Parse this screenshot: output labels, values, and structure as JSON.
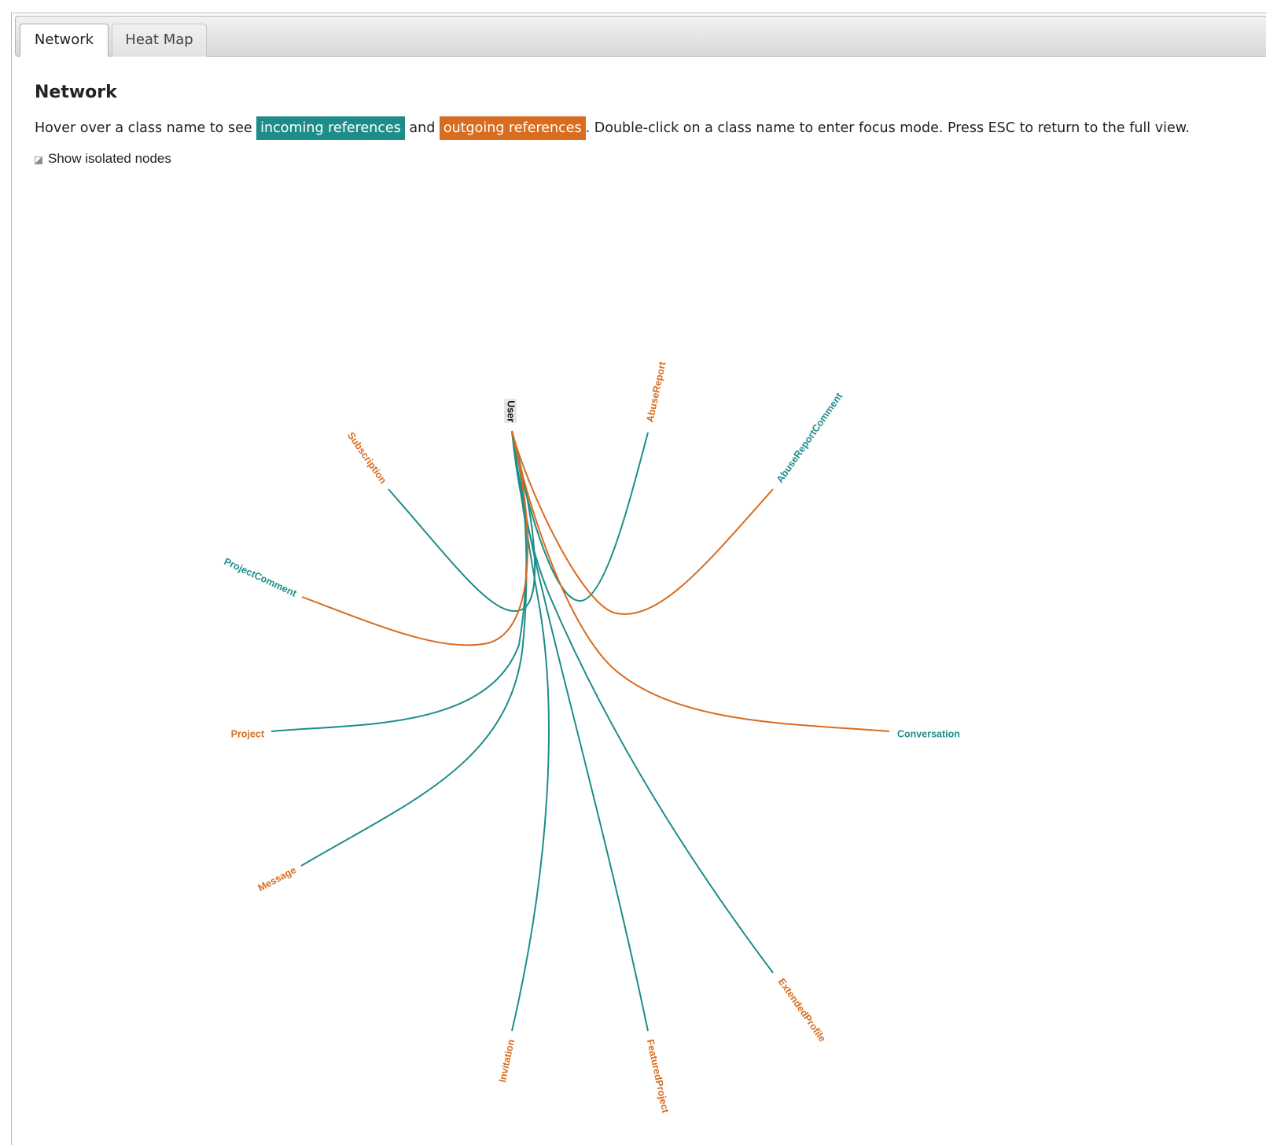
{
  "tabs": [
    {
      "label": "Network",
      "active": true
    },
    {
      "label": "Heat Map",
      "active": false
    }
  ],
  "heading": "Network",
  "description": {
    "prefix": "Hover over a class name to see ",
    "incoming": "incoming references",
    "middle": " and ",
    "outgoing": "outgoing references",
    "suffix": ". Double-click on a class name to enter focus mode. Press ESC to return to the full view."
  },
  "isolated_nodes": {
    "label": "Show isolated nodes",
    "checked": true
  },
  "colors": {
    "incoming": "#1e8d8a",
    "outgoing": "#d86c1f",
    "focus_bg": "#e6e6e6"
  },
  "network": {
    "focus": "User",
    "nodes": [
      {
        "name": "User",
        "role": "focus"
      },
      {
        "name": "AbuseReport",
        "role": "outgoing"
      },
      {
        "name": "AbuseReportComment",
        "role": "incoming"
      },
      {
        "name": "Conversation",
        "role": "incoming"
      },
      {
        "name": "ExtendedProfile",
        "role": "outgoing"
      },
      {
        "name": "FeaturedProject",
        "role": "outgoing"
      },
      {
        "name": "Invitation",
        "role": "outgoing"
      },
      {
        "name": "Message",
        "role": "outgoing"
      },
      {
        "name": "Project",
        "role": "outgoing"
      },
      {
        "name": "ProjectComment",
        "role": "incoming"
      },
      {
        "name": "Subscription",
        "role": "outgoing"
      }
    ]
  }
}
